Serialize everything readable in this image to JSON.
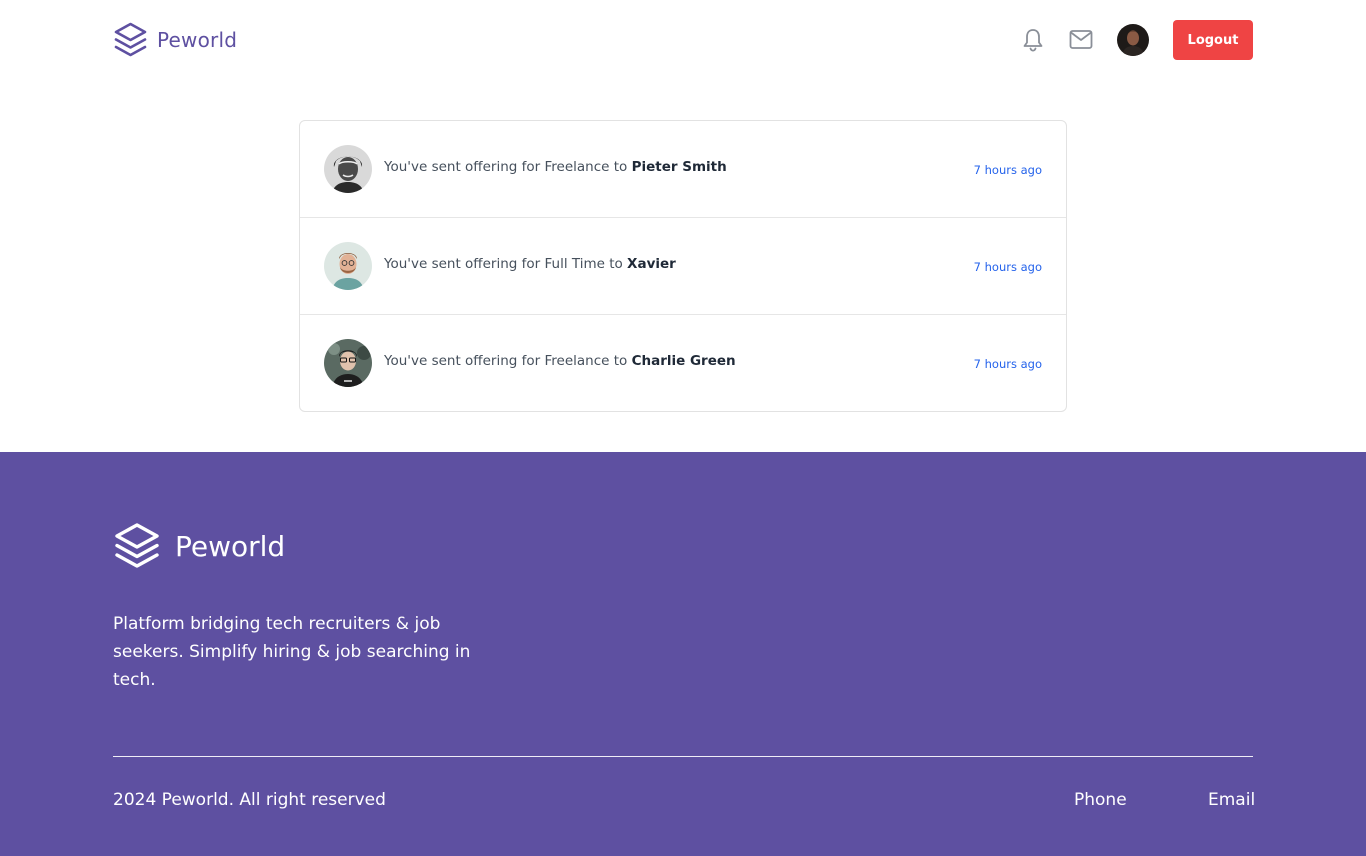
{
  "header": {
    "brand_name": "Peworld",
    "logout_label": "Logout"
  },
  "notifications": [
    {
      "prefix": "You've sent offering for Freelance to ",
      "name": "Pieter Smith",
      "time": "7 hours ago"
    },
    {
      "prefix": "You've sent offering for Full Time to ",
      "name": "Xavier",
      "time": "7 hours ago"
    },
    {
      "prefix": "You've sent offering for Freelance to ",
      "name": "Charlie Green",
      "time": "7 hours ago"
    }
  ],
  "footer": {
    "brand_name": "Peworld",
    "description": "Platform bridging tech recruiters & job seekers. Simplify hiring & job searching in tech.",
    "copyright": "2024 Peworld. All right reserved",
    "phone_label": "Phone",
    "email_label": "Email"
  },
  "colors": {
    "brand_purple": "#5e50a1",
    "logout_red": "#ef4444",
    "time_blue": "#2563eb"
  },
  "icons": {
    "brand": "layers-icon",
    "notifications": "bell-icon",
    "messages": "mail-icon"
  }
}
